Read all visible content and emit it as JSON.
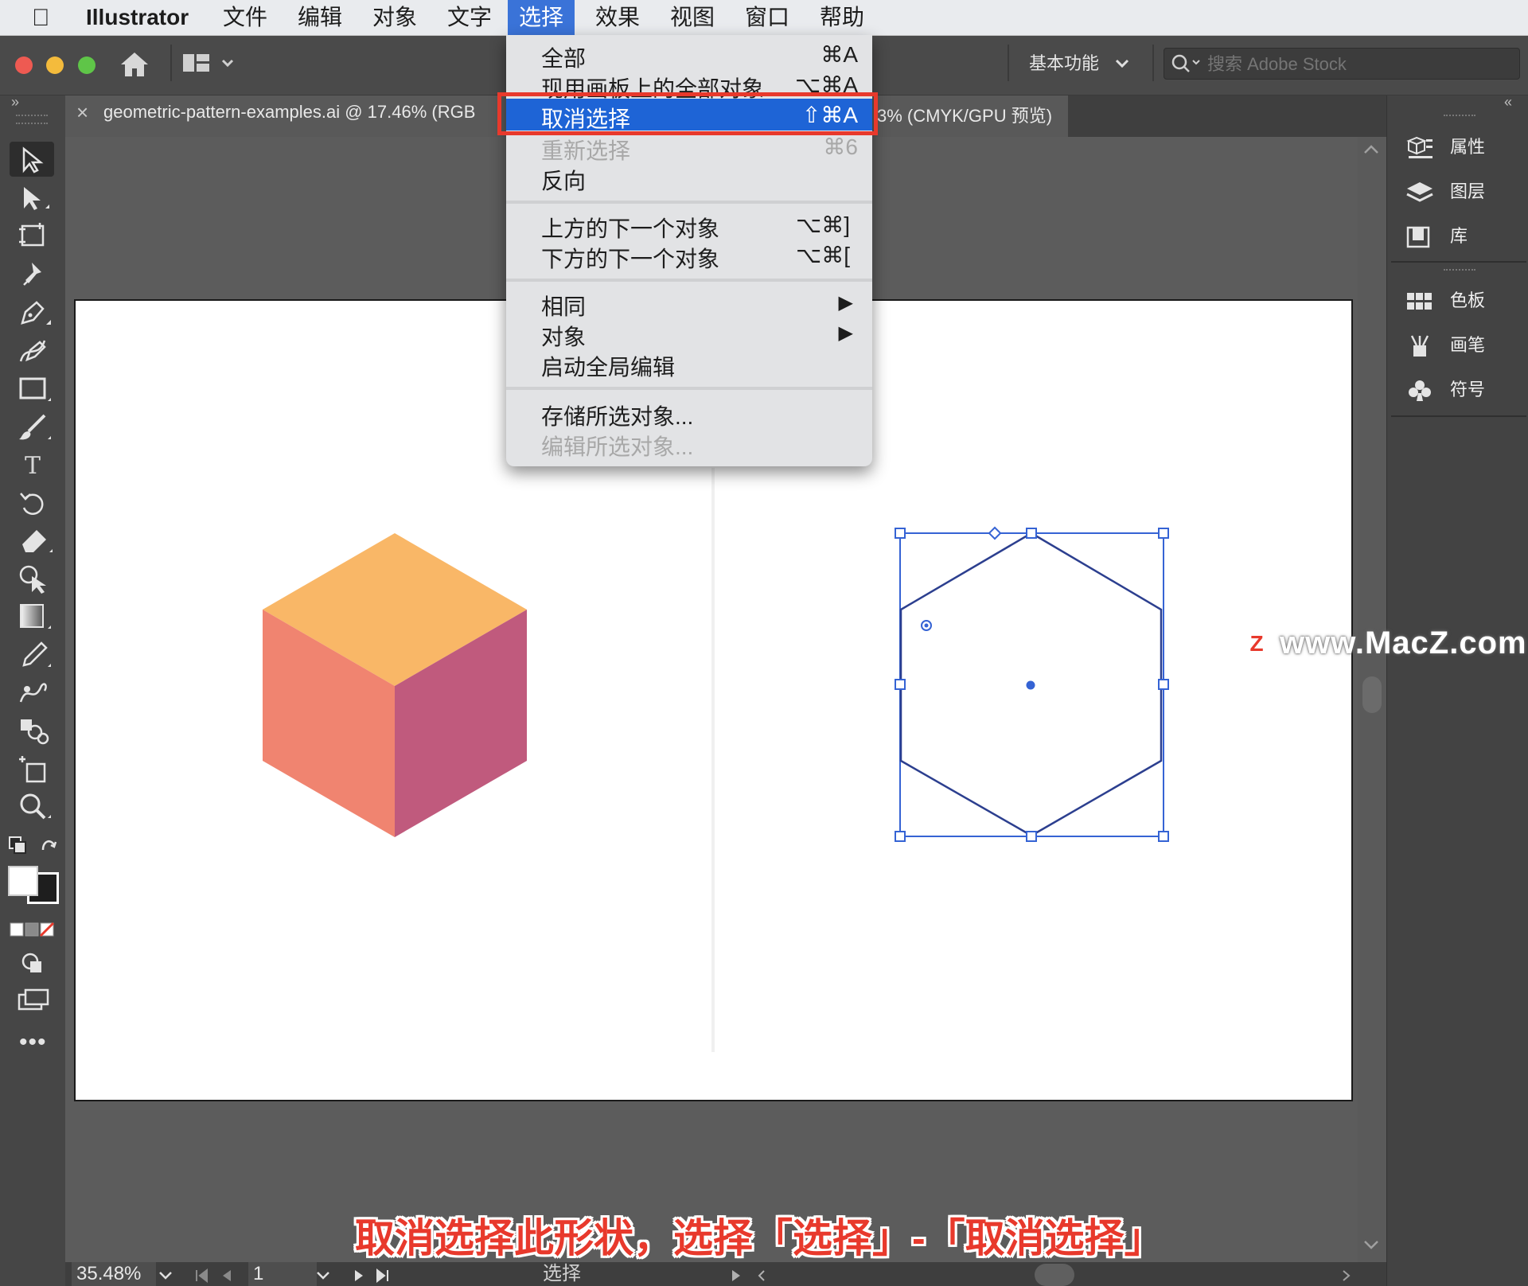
{
  "menubar": {
    "app_name": "Illustrator",
    "items": [
      "文件",
      "编辑",
      "对象",
      "文字",
      "选择",
      "效果",
      "视图",
      "窗口",
      "帮助"
    ],
    "active_item": "选择"
  },
  "toolbar": {
    "workspace": "基本功能",
    "search_placeholder": "搜索 Adobe Stock"
  },
  "document": {
    "tab_title": "geometric-pattern-examples.ai @ 17.46% (RGB",
    "tab_title_tail": "3% (CMYK/GPU 预览)",
    "close_glyph": "×"
  },
  "select_menu": {
    "items": [
      {
        "label": "全部",
        "shortcut": "⌘A",
        "disabled": false
      },
      {
        "label": "现用画板上的全部对象",
        "shortcut": "⌥⌘A",
        "disabled": false
      },
      {
        "label": "取消选择",
        "shortcut": "⇧⌘A",
        "disabled": false,
        "highlighted": true
      },
      {
        "label": "重新选择",
        "shortcut": "⌘6",
        "disabled": true
      },
      {
        "label": "反向",
        "shortcut": "",
        "disabled": false
      },
      {
        "label": "上方的下一个对象",
        "shortcut": "⌥⌘]",
        "disabled": false
      },
      {
        "label": "下方的下一个对象",
        "shortcut": "⌥⌘[",
        "disabled": false
      },
      {
        "label": "相同",
        "shortcut": "▶",
        "disabled": false
      },
      {
        "label": "对象",
        "shortcut": "▶",
        "disabled": false
      },
      {
        "label": "启动全局编辑",
        "shortcut": "",
        "disabled": false
      },
      {
        "label": "存储所选对象...",
        "shortcut": "",
        "disabled": false
      },
      {
        "label": "编辑所选对象...",
        "shortcut": "",
        "disabled": true
      }
    ]
  },
  "right_panel": {
    "items": [
      "属性",
      "图层",
      "库",
      "色板",
      "画笔",
      "符号"
    ]
  },
  "status": {
    "zoom": "35.48%",
    "page": "1",
    "status_text": "选择"
  },
  "colors": {
    "cube_top": "#f9b767",
    "cube_left": "#f08470",
    "cube_right": "#c05a7d",
    "selection_blue": "#3563d4",
    "menu_highlight": "#1e64d6",
    "callout_red": "#e8392c"
  },
  "watermark": {
    "badge": "Z",
    "text": "www.MacZ.com"
  },
  "caption": "取消选择此形状，选择「选择」-「取消选择」"
}
